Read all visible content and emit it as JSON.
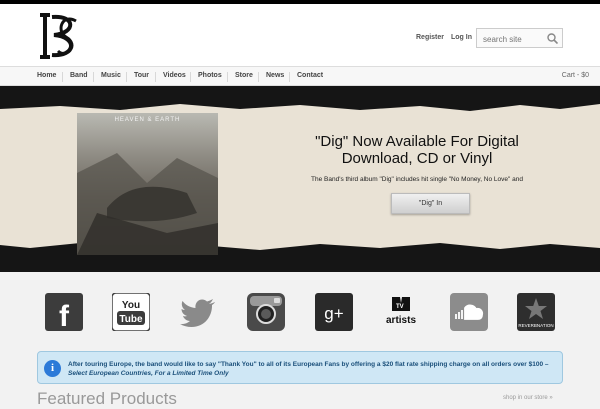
{
  "header": {
    "logo_alt": "IBC",
    "register": "Register",
    "login": "Log In",
    "search_placeholder": "search site"
  },
  "nav": {
    "items": [
      "Home",
      "Band",
      "Music",
      "Tour",
      "Videos",
      "Photos",
      "Store",
      "News",
      "Contact"
    ],
    "cart": "Cart - $0"
  },
  "hero": {
    "album_title": "HEAVEN & EARTH",
    "headline_line1": "\"Dig\" Now Available For Digital",
    "headline_line2": "Download, CD or Vinyl",
    "subtext": "The Band's third album \"Dig\" includes hit single \"No Money, No Love\" and",
    "button": "\"Dig\" In"
  },
  "social": [
    {
      "name": "facebook",
      "label": "f"
    },
    {
      "name": "youtube",
      "label1": "You",
      "label2": "Tube"
    },
    {
      "name": "twitter"
    },
    {
      "name": "instagram"
    },
    {
      "name": "google-plus",
      "label": "g+"
    },
    {
      "name": "mtv-artists",
      "label": "artists"
    },
    {
      "name": "soundcloud"
    },
    {
      "name": "reverbnation",
      "label": "REVERBNATION"
    }
  ],
  "notice": {
    "text": "After touring Europe, the band would like to say \"Thank You\" to all of its European Fans by offering a $20 flat rate shipping charge on all orders over $100 – ",
    "emphasis": "Select European Countries, For a Limited Time Only"
  },
  "featured": {
    "title": "Featured Products",
    "shop_link": "shop in our store »"
  },
  "colors": {
    "accent": "#2c7ad8",
    "notice_bg": "#cfe7f5",
    "hero_bg": "#e9e2d5"
  }
}
